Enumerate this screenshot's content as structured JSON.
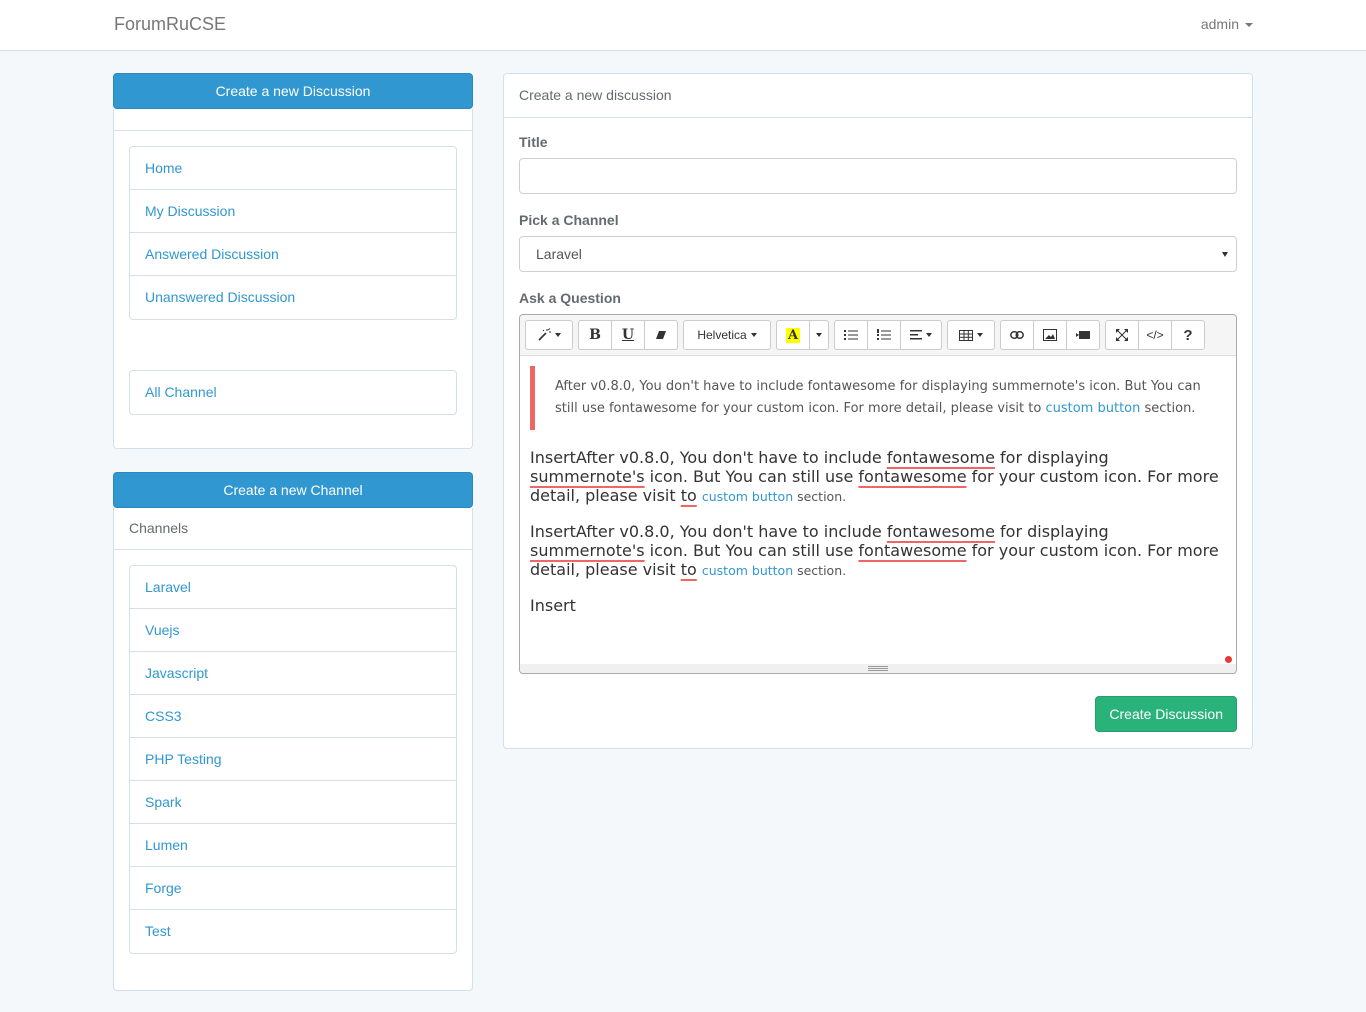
{
  "navbar": {
    "brand": "ForumRuCSE",
    "user": "admin"
  },
  "left": {
    "create_discussion_label": "Create a new Discussion",
    "nav_items": [
      {
        "label": "Home"
      },
      {
        "label": "My Discussion"
      },
      {
        "label": "Answered Discussion"
      },
      {
        "label": "Unanswered Discussion"
      }
    ],
    "all_channel_label": "All Channel",
    "create_channel_label": "Create a new Channel",
    "channels_heading": "Channels",
    "channels": [
      {
        "label": "Laravel"
      },
      {
        "label": "Vuejs"
      },
      {
        "label": "Javascript"
      },
      {
        "label": "CSS3"
      },
      {
        "label": "PHP Testing"
      },
      {
        "label": "Spark"
      },
      {
        "label": "Lumen"
      },
      {
        "label": "Forge"
      },
      {
        "label": "Test"
      }
    ]
  },
  "form": {
    "heading": "Create a new discussion",
    "title_label": "Title",
    "title_value": "",
    "channel_label": "Pick a Channel",
    "channel_selected": "Laravel",
    "question_label": "Ask a Question",
    "submit_label": "Create Discussion"
  },
  "editor": {
    "toolbar": {
      "font_name": "Helvetica",
      "highlight_letter": "A",
      "help_label": "?",
      "bold_label": "B",
      "underline_label": "U",
      "code_label": "</>"
    },
    "blockquote": {
      "text": "After v0.8.0, You don't have to include fontawesome for displaying summernote's icon. But You can still use fontawesome for your custom icon. For more detail, please visit to",
      "link": "custom button",
      "after": " section."
    },
    "paragraphs": [
      {
        "prefix": "InsertAfter v0.8.0, You don't have to include ",
        "w1": "fontawesome",
        "mid1": " for displaying ",
        "w2": "summernote's",
        "mid2": " icon. But You can still use ",
        "w3": "fontawesome",
        "mid3": " for your custom icon. For more detail, please visit ",
        "w4": "to",
        "link": "custom button",
        "after": " section."
      },
      {
        "prefix": "InsertAfter v0.8.0, You don't have to include ",
        "w1": "fontawesome",
        "mid1": " for displaying ",
        "w2": "summernote's",
        "mid2": " icon. But You can still use ",
        "w3": "fontawesome",
        "mid3": " for your custom icon. For more detail, please visit ",
        "w4": "to",
        "link": "custom button",
        "after": " section."
      }
    ],
    "last_line": "Insert"
  },
  "colors": {
    "primary": "#3097d1",
    "success": "#2ab27b",
    "blockquote_border": "#e66666",
    "background": "#f5f8fa"
  }
}
